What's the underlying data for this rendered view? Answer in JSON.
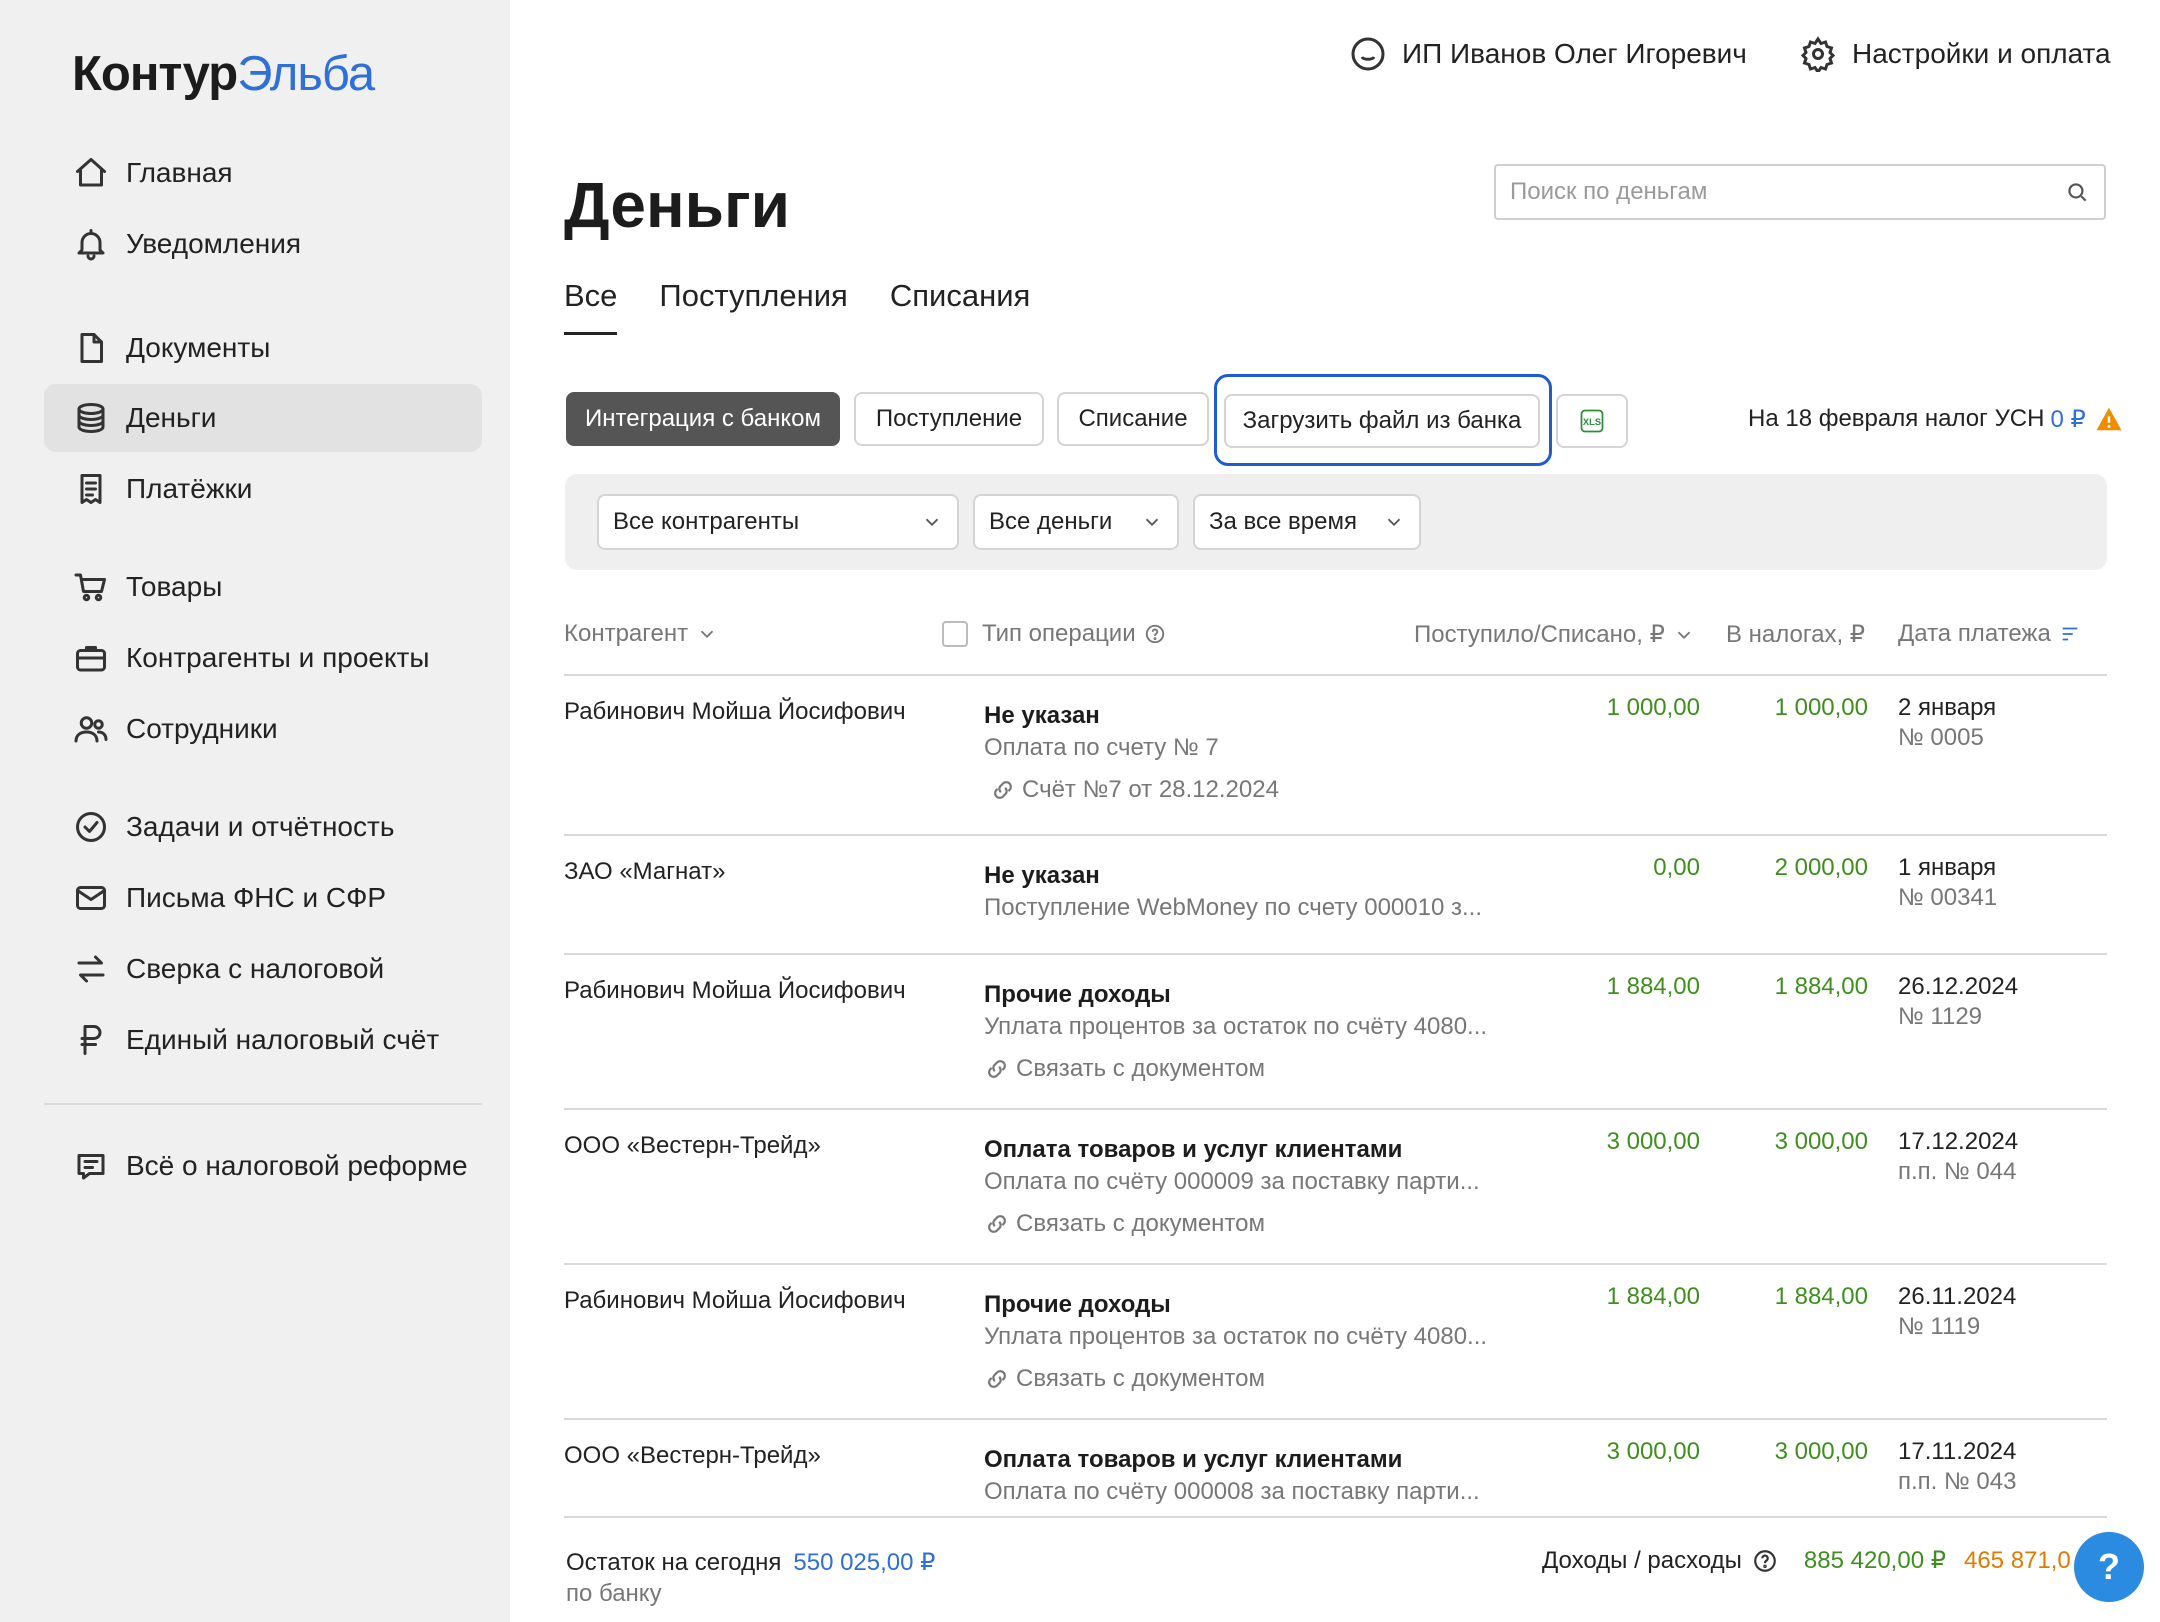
{
  "brand": {
    "part1": "Контур",
    "part2": "Эльба"
  },
  "sidebar": {
    "items": [
      {
        "label": "Главная",
        "icon": "home-icon"
      },
      {
        "label": "Уведомления",
        "icon": "bell-icon"
      },
      {
        "label": "Документы",
        "icon": "document-icon"
      },
      {
        "label": "Деньги",
        "icon": "coins-icon",
        "active": true
      },
      {
        "label": "Платёжки",
        "icon": "receipt-icon"
      },
      {
        "label": "Товары",
        "icon": "cart-icon"
      },
      {
        "label": "Контрагенты и проекты",
        "icon": "briefcase-icon"
      },
      {
        "label": "Сотрудники",
        "icon": "people-icon"
      },
      {
        "label": "Задачи и отчётность",
        "icon": "check-circle-icon"
      },
      {
        "label": "Письма ФНС и СФР",
        "icon": "mail-icon"
      },
      {
        "label": "Сверка с налоговой",
        "icon": "arrows-icon"
      },
      {
        "label": "Единый налоговый счёт",
        "icon": "ruble-icon"
      },
      {
        "label": "Всё о налоговой реформе",
        "icon": "book-icon"
      }
    ]
  },
  "topbar": {
    "user": "ИП Иванов Олег Игоревич",
    "settings": "Настройки и оплата"
  },
  "page": {
    "title": "Деньги"
  },
  "search": {
    "placeholder": "Поиск по деньгам",
    "value": ""
  },
  "tabs": [
    {
      "label": "Все",
      "active": true
    },
    {
      "label": "Поступления"
    },
    {
      "label": "Списания"
    }
  ],
  "actions": {
    "bank_integration": "Интеграция с банком",
    "income": "Поступление",
    "expense": "Списание",
    "upload_bank_file": "Загрузить файл из банка",
    "xls": "XLS"
  },
  "tax_note": {
    "text": "На 18 февраля налог УСН",
    "value": "0 ₽"
  },
  "filters": {
    "counterparties": "Все контрагенты",
    "money": "Все деньги",
    "period": "За все время"
  },
  "table": {
    "headers": {
      "counterparty": "Контрагент",
      "operation_type": "Тип операции",
      "amount": "Поступило/Списано, ₽",
      "in_taxes": "В налогах, ₽",
      "payment_date": "Дата платежа"
    },
    "rows": [
      {
        "counterparty": "Рабинович Мойша Йосифович",
        "type": "Не указан",
        "description": "Оплата по счету № 7",
        "link": "Счёт №7 от 28.12.2024",
        "amount": "1 000,00",
        "tax": "1 000,00",
        "date": "2 января",
        "number": "№ 0005"
      },
      {
        "counterparty": "ЗАО «Магнат»",
        "type": "Не указан",
        "description": "Поступление WebMoney по счету 000010 з...",
        "link": "",
        "amount": "0,00",
        "tax": "2 000,00",
        "date": "1 января",
        "number": "№ 00341"
      },
      {
        "counterparty": "Рабинович Мойша Йосифович",
        "type": "Прочие доходы",
        "description": "Уплата процентов за остаток по счёту 4080...",
        "link": "Связать с документом",
        "amount": "1 884,00",
        "tax": "1 884,00",
        "date": "26.12.2024",
        "number": "№ 1129"
      },
      {
        "counterparty": "ООО «Вестерн-Трейд»",
        "type": "Оплата товаров и услуг клиентами",
        "description": "Оплата по счёту 000009 за поставку парти...",
        "link": "Связать с документом",
        "amount": "3 000,00",
        "tax": "3 000,00",
        "date": "17.12.2024",
        "number": "п.п. № 044"
      },
      {
        "counterparty": "Рабинович Мойша Йосифович",
        "type": "Прочие доходы",
        "description": "Уплата процентов за остаток по счёту 4080...",
        "link": "Связать с документом",
        "amount": "1 884,00",
        "tax": "1 884,00",
        "date": "26.11.2024",
        "number": "№ 1119"
      },
      {
        "counterparty": "ООО «Вестерн-Трейд»",
        "type": "Оплата товаров и услуг клиентами",
        "description": "Оплата по счёту 000008 за поставку парти...",
        "link": "",
        "amount": "3 000,00",
        "tax": "3 000,00",
        "date": "17.11.2024",
        "number": "п.п. № 043"
      }
    ]
  },
  "footer": {
    "balance_label": "Остаток на сегодня",
    "balance_value": "550 025,00 ₽",
    "balance_sub": "по банку",
    "income_expense_label": "Доходы / расходы",
    "income": "885 420,00 ₽",
    "expense": "465 871,0"
  },
  "help": {
    "label": "?"
  },
  "colors": {
    "accent": "#2f6fd6",
    "income": "#3f8f1f",
    "expense": "#e07b00",
    "focus": "#1f5bd6",
    "warning": "#f08c00"
  }
}
